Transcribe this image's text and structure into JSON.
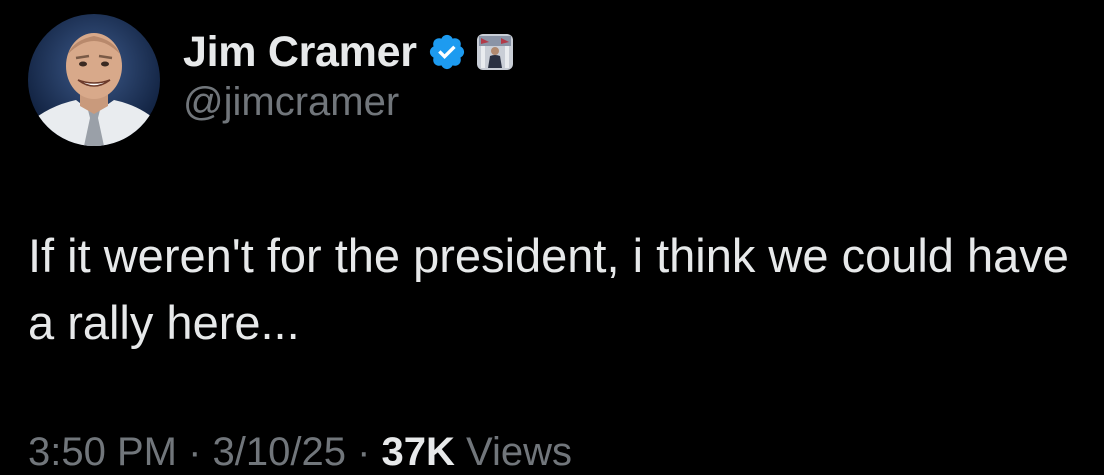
{
  "author": {
    "display_name": "Jim Cramer",
    "handle": "@jimcramer",
    "verified": true,
    "verified_color": "#1d9bf0"
  },
  "tweet": {
    "text": "If it weren't for the president, i think we could have a rally here..."
  },
  "meta": {
    "time": "3:50 PM",
    "separator1": " · ",
    "date": "3/10/25",
    "separator2": " · ",
    "views_count": "37K",
    "views_label": " Views"
  },
  "theme": {
    "background": "#000000",
    "text_primary": "#e7e9ea",
    "text_secondary": "#71767b"
  },
  "icons": {
    "verified": "verified-badge-icon",
    "affiliate": "affiliate-badge-icon"
  }
}
